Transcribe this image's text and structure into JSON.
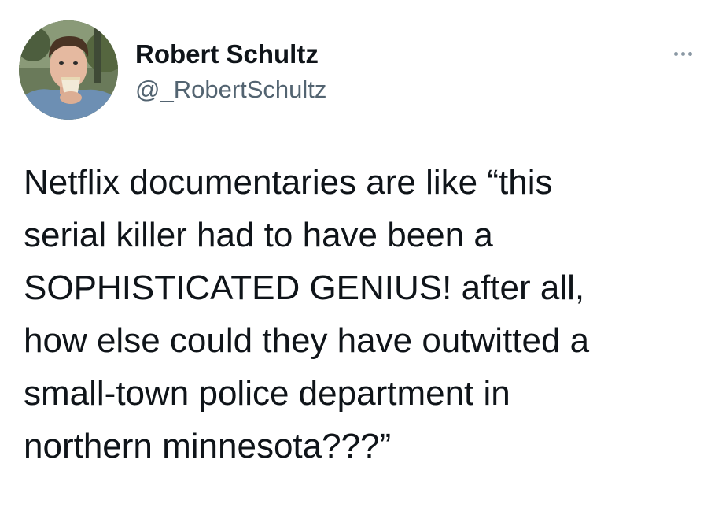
{
  "tweet": {
    "author": {
      "display_name": "Robert Schultz",
      "handle": "@_RobertSchultz",
      "avatar_icon": "profile-photo"
    },
    "more_icon": "more-dots-icon",
    "text_lines": [
      "Netflix documentaries are like “this",
      "serial killer had to have been a",
      "SOPHISTICATED GENIUS! after all,",
      "how else could they have outwitted a",
      "small-town police department in",
      "northern minnesota???”"
    ]
  },
  "colors": {
    "background": "#ffffff",
    "text_primary": "#0f1419",
    "text_secondary": "#536471"
  }
}
